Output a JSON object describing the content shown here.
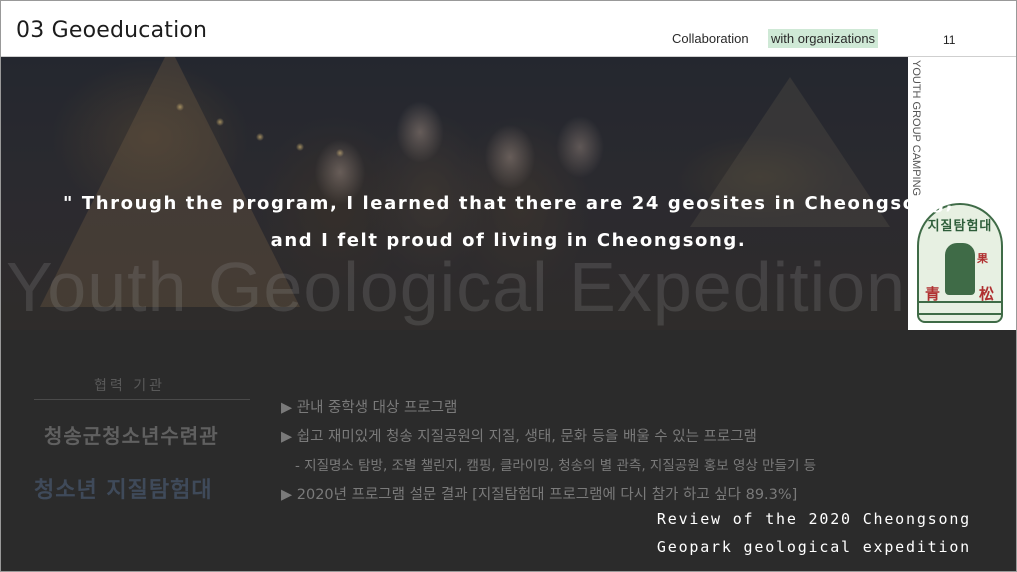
{
  "header": {
    "title": "03 Geoeducation",
    "subtitle_prefix": "Collaboration",
    "subtitle_highlight": "with organizations",
    "page_number": "11"
  },
  "photo": {
    "side_label": "YOUTH GROUP CAMPING",
    "watermark": "Youth Geological Expedition",
    "quote_line1": "\" Through the program, I learned that there are 24 geosites in Cheongsong,",
    "quote_line2": "and I felt proud of living in Cheongsong.",
    "seal": {
      "arc": "지질탐험대",
      "left_char": "青",
      "right_char": "松",
      "mid_char": "果"
    }
  },
  "partner": {
    "heading": "협력 기관",
    "name": "청송군청소년수련관",
    "logo_text": "청소년 지질탐험대"
  },
  "bullets": [
    "▶ 관내 중학생 대상 프로그램",
    "▶ 쉽고 재미있게 청송 지질공원의 지질, 생태, 문화 등을 배울 수 있는 프로그램",
    "- 지질명소 탐방, 조별 챌린지, 캠핑, 클라이밍, 청송의 별 관측, 지질공원 홍보 영상 만들기 등",
    "▶ 2020년 프로그램 설문 결과 [지질탐험대 프로그램에 다시 참가 하고 싶다 89.3%]"
  ],
  "review": {
    "line1": "Review of the 2020 Cheongsong",
    "line2": "Geopark geological expedition"
  }
}
